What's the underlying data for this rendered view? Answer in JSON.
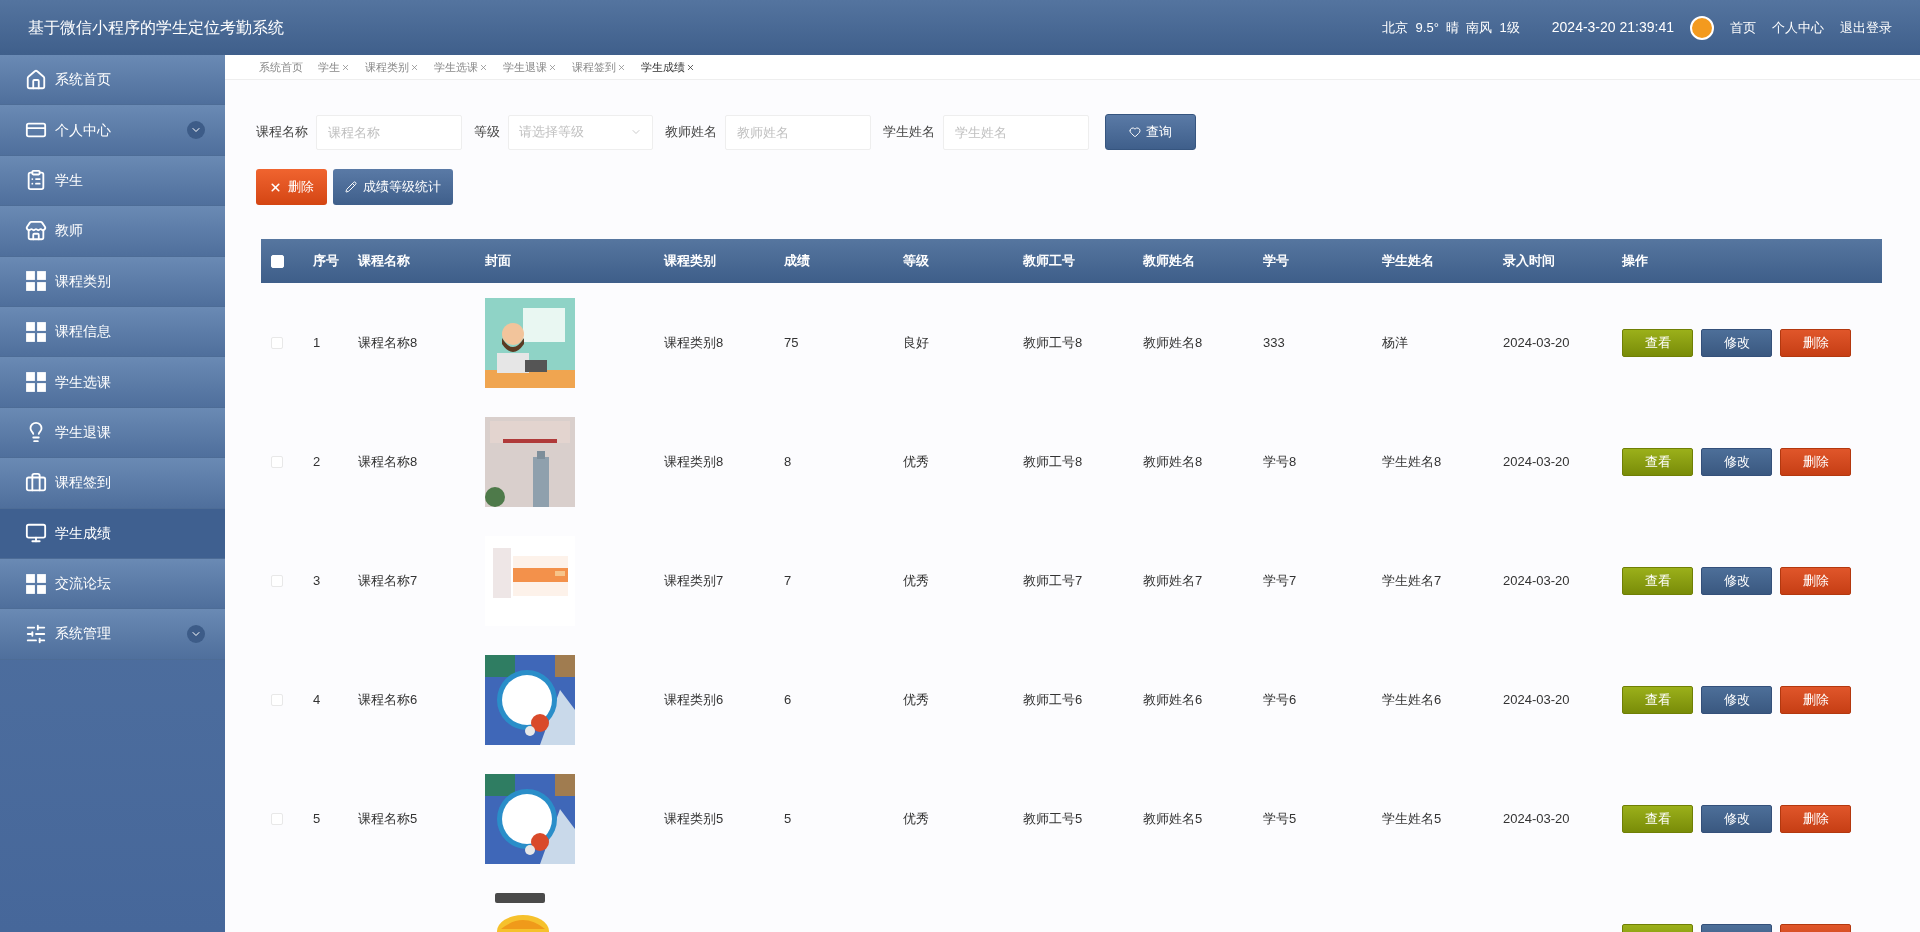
{
  "header": {
    "title": "基于微信小程序的学生定位考勤系统",
    "weather": "北京  9.5°  晴  南风  1级",
    "datetime": "2024-3-20 21:39:41",
    "links": [
      "首页",
      "个人中心",
      "退出登录"
    ]
  },
  "sidebar": {
    "items": [
      {
        "label": "系统首页",
        "has_submenu": false,
        "selected": false
      },
      {
        "label": "个人中心",
        "has_submenu": true,
        "selected": false
      },
      {
        "label": "学生",
        "has_submenu": false,
        "selected": false
      },
      {
        "label": "教师",
        "has_submenu": false,
        "selected": false
      },
      {
        "label": "课程类别",
        "has_submenu": false,
        "selected": false
      },
      {
        "label": "课程信息",
        "has_submenu": false,
        "selected": false
      },
      {
        "label": "学生选课",
        "has_submenu": false,
        "selected": false
      },
      {
        "label": "学生退课",
        "has_submenu": false,
        "selected": false
      },
      {
        "label": "课程签到",
        "has_submenu": false,
        "selected": false
      },
      {
        "label": "学生成绩",
        "has_submenu": false,
        "selected": true
      },
      {
        "label": "交流论坛",
        "has_submenu": false,
        "selected": false
      },
      {
        "label": "系统管理",
        "has_submenu": true,
        "selected": false
      }
    ]
  },
  "tabs": [
    {
      "label": "系统首页",
      "closable": false,
      "selected": false
    },
    {
      "label": "学生",
      "closable": true,
      "selected": false
    },
    {
      "label": "课程类别",
      "closable": true,
      "selected": false
    },
    {
      "label": "学生选课",
      "closable": true,
      "selected": false
    },
    {
      "label": "学生退课",
      "closable": true,
      "selected": false
    },
    {
      "label": "课程签到",
      "closable": true,
      "selected": false
    },
    {
      "label": "学生成绩",
      "closable": true,
      "selected": true
    }
  ],
  "filters": [
    {
      "label": "课程名称",
      "placeholder": "课程名称",
      "kind": "text"
    },
    {
      "label": "等级",
      "placeholder": "请选择等级",
      "kind": "select"
    },
    {
      "label": "教师姓名",
      "placeholder": "教师姓名",
      "kind": "text"
    },
    {
      "label": "学生姓名",
      "placeholder": "学生姓名",
      "kind": "text"
    }
  ],
  "search_button": "查询",
  "actions": [
    {
      "label": "删除",
      "kind": "delete"
    },
    {
      "label": "成绩等级统计",
      "kind": "stats"
    }
  ],
  "table": {
    "select_all": {
      "checked": false
    },
    "columns": [
      "序号",
      "课程名称",
      "封面",
      "课程类别",
      "成绩",
      "等级",
      "教师工号",
      "教师姓名",
      "学号",
      "学生姓名",
      "录入时间",
      "操作"
    ],
    "rows": [
      {
        "checked": false,
        "cells": [
          "1",
          "课程名称8",
          "",
          "课程类别8",
          "75",
          "良好",
          "教师工号8",
          "教师姓名8",
          "333",
          "杨洋",
          "2024-03-20"
        ],
        "cover": {
          "kind": "picture"
        },
        "actions": [
          {
            "label": "查看",
            "kind": "view"
          },
          {
            "label": "修改",
            "kind": "edit"
          },
          {
            "label": "删除",
            "kind": "delete"
          }
        ]
      },
      {
        "checked": false,
        "cells": [
          "2",
          "课程名称8",
          "",
          "课程类别8",
          "8",
          "优秀",
          "教师工号8",
          "教师姓名8",
          "学号8",
          "学生姓名8",
          "2024-03-20"
        ],
        "cover": {
          "kind": "picture"
        },
        "actions": [
          {
            "label": "查看",
            "kind": "view"
          },
          {
            "label": "修改",
            "kind": "edit"
          },
          {
            "label": "删除",
            "kind": "delete"
          }
        ]
      },
      {
        "checked": false,
        "cells": [
          "3",
          "课程名称7",
          "",
          "课程类别7",
          "7",
          "优秀",
          "教师工号7",
          "教师姓名7",
          "学号7",
          "学生姓名7",
          "2024-03-20"
        ],
        "cover": {
          "kind": "picture"
        },
        "actions": [
          {
            "label": "查看",
            "kind": "view"
          },
          {
            "label": "修改",
            "kind": "edit"
          },
          {
            "label": "删除",
            "kind": "delete"
          }
        ]
      },
      {
        "checked": false,
        "cells": [
          "4",
          "课程名称6",
          "",
          "课程类别6",
          "6",
          "优秀",
          "教师工号6",
          "教师姓名6",
          "学号6",
          "学生姓名6",
          "2024-03-20"
        ],
        "cover": {
          "kind": "picture"
        },
        "actions": [
          {
            "label": "查看",
            "kind": "view"
          },
          {
            "label": "修改",
            "kind": "edit"
          },
          {
            "label": "删除",
            "kind": "delete"
          }
        ]
      },
      {
        "checked": false,
        "cells": [
          "5",
          "课程名称5",
          "",
          "课程类别5",
          "5",
          "优秀",
          "教师工号5",
          "教师姓名5",
          "学号5",
          "学生姓名5",
          "2024-03-20"
        ],
        "cover": {
          "kind": "picture"
        },
        "actions": [
          {
            "label": "查看",
            "kind": "view"
          },
          {
            "label": "修改",
            "kind": "edit"
          },
          {
            "label": "删除",
            "kind": "delete"
          }
        ]
      }
    ],
    "partial_row": {
      "cover": {
        "kind": "picture"
      },
      "actions": [
        {
          "kind": "view"
        },
        {
          "kind": "edit"
        },
        {
          "kind": "delete"
        }
      ]
    }
  }
}
